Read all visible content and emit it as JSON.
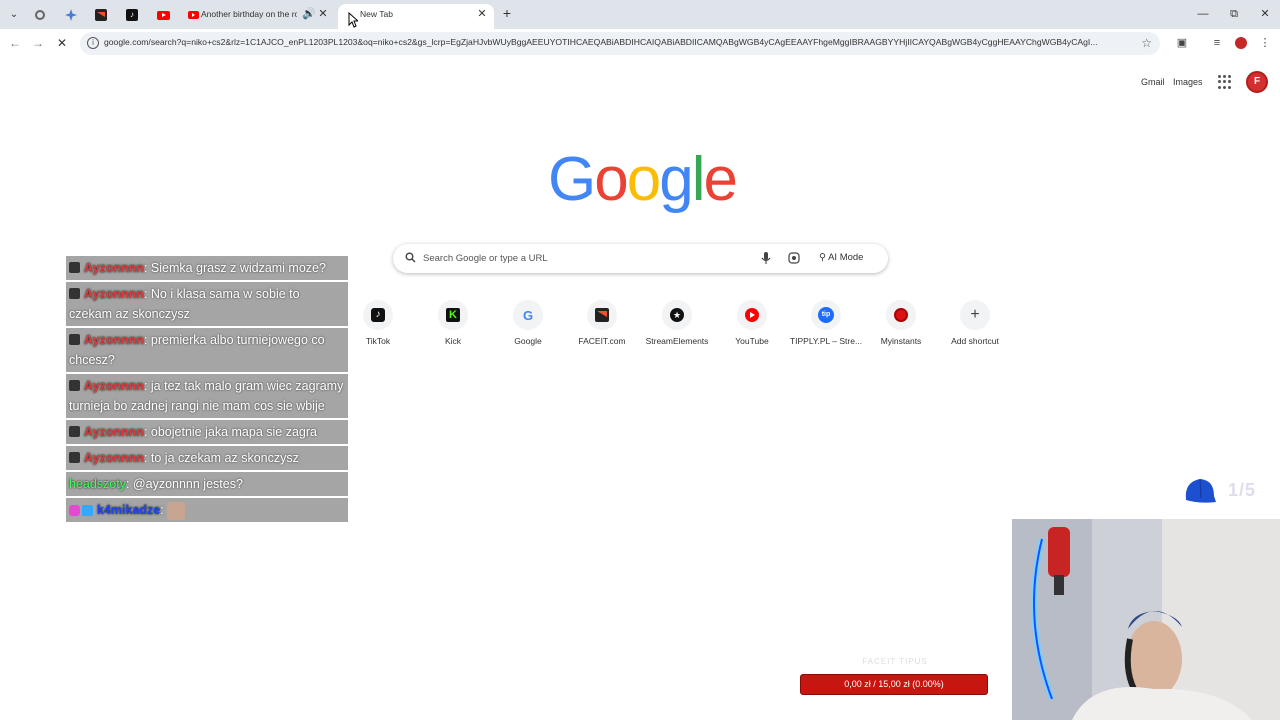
{
  "browser": {
    "tabs": [
      {
        "title": "Another birthday on the ro",
        "kind": "youtube"
      },
      {
        "title": "New Tab",
        "kind": "newtab",
        "active": true
      }
    ],
    "url": "google.com/search?q=niko+cs2&rlz=1C1AJCO_enPL1203PL1203&oq=niko+cs2&gs_lcrp=EgZjaHJvbWUyBggAEEUYOTIHCAEQABiABDIHCAIQABiABDIICAMQABgWGB4yCAgEEAAYFhgeMggIBRAAGBYYHjIICAYQABgWGB4yCggHEAAYChgWGB4yCAgI..."
  },
  "google": {
    "header_links": {
      "gmail": "Gmail",
      "images": "Images"
    },
    "avatar_letter": "F",
    "search_placeholder": "Search Google or type a URL",
    "ai_mode": "AI Mode",
    "shortcuts": [
      {
        "label": "TikTok",
        "icon": "tiktok-icon"
      },
      {
        "label": "Kick",
        "icon": "kick-icon"
      },
      {
        "label": "Google",
        "icon": "google-icon"
      },
      {
        "label": "FACEIT.com",
        "icon": "faceit-icon"
      },
      {
        "label": "StreamElements",
        "icon": "streamelements-icon"
      },
      {
        "label": "YouTube",
        "icon": "youtube-icon"
      },
      {
        "label": "TIPPLY.PL – Stre...",
        "icon": "tipply-icon"
      },
      {
        "label": "Myinstants",
        "icon": "myinstants-icon"
      },
      {
        "label": "Add shortcut",
        "icon": "plus-icon"
      }
    ]
  },
  "chat": {
    "messages": [
      {
        "user": "Ayzonnnn",
        "text": ": Siemka grasz z widzami moze?"
      },
      {
        "user": "Ayzonnnn",
        "text": ": No i klasa sama w sobie to czekam az skonczysz"
      },
      {
        "user": "Ayzonnnn",
        "text": ": premierka albo turniejowego co chcesz?"
      },
      {
        "user": "Ayzonnnn",
        "text": ": ja tez tak malo gram wiec zagramy turnieja bo zadnej rangi nie mam cos sie wbije"
      },
      {
        "user": "Ayzonnnn",
        "text": ": obojetnie jaka mapa sie zagra"
      },
      {
        "user": "Ayzonnnn",
        "text": ": to ja czekam az skonczysz"
      },
      {
        "user": "headszoty",
        "text": ": @ayzonnnn jestes?"
      },
      {
        "user": "k4mikadze",
        "text": ":"
      }
    ]
  },
  "overlay": {
    "counter": "1/5",
    "faceit_label": "FACEIT TIPUS",
    "donation_bar": "0,00 zł / 15,00 zł (0.00%)",
    "donation_progress": 0.0
  }
}
